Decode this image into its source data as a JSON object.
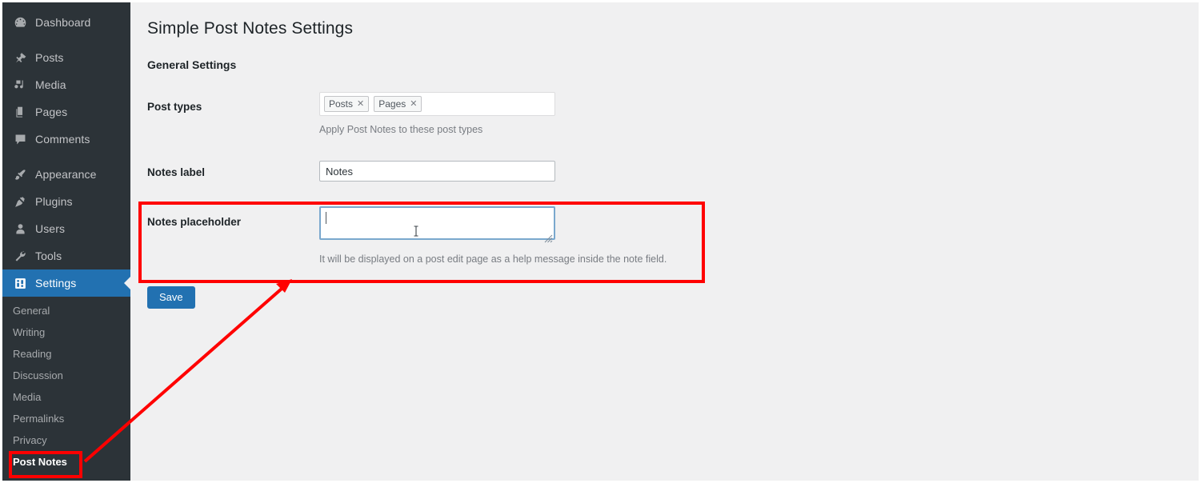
{
  "sidebar": {
    "items": [
      {
        "label": "Dashboard",
        "icon": "dashboard-icon",
        "name": "sidebar-item-dashboard"
      },
      {
        "label": "Posts",
        "icon": "pin-icon",
        "name": "sidebar-item-posts"
      },
      {
        "label": "Media",
        "icon": "media-icon",
        "name": "sidebar-item-media"
      },
      {
        "label": "Pages",
        "icon": "pages-icon",
        "name": "sidebar-item-pages"
      },
      {
        "label": "Comments",
        "icon": "comment-icon",
        "name": "sidebar-item-comments"
      },
      {
        "label": "Appearance",
        "icon": "paintbrush-icon",
        "name": "sidebar-item-appearance"
      },
      {
        "label": "Plugins",
        "icon": "plug-icon",
        "name": "sidebar-item-plugins"
      },
      {
        "label": "Users",
        "icon": "user-icon",
        "name": "sidebar-item-users"
      },
      {
        "label": "Tools",
        "icon": "wrench-icon",
        "name": "sidebar-item-tools"
      },
      {
        "label": "Settings",
        "icon": "sliders-icon",
        "name": "sidebar-item-settings"
      }
    ],
    "submenu": [
      {
        "label": "General"
      },
      {
        "label": "Writing"
      },
      {
        "label": "Reading"
      },
      {
        "label": "Discussion"
      },
      {
        "label": "Media"
      },
      {
        "label": "Permalinks"
      },
      {
        "label": "Privacy"
      },
      {
        "label": "Post Notes"
      }
    ],
    "active_item": "Settings",
    "current_submenu": "Post Notes",
    "colors": {
      "background": "#2c3338",
      "active": "#2271b1",
      "text": "#c3c4c7",
      "submenu_text": "#a7aaad"
    }
  },
  "header": {
    "page_title": "Simple Post Notes Settings",
    "section_title": "General Settings"
  },
  "form": {
    "post_types": {
      "label": "Post types",
      "tags": [
        {
          "label": "Posts",
          "remove": "✕"
        },
        {
          "label": "Pages",
          "remove": "✕"
        }
      ],
      "help": "Apply Post Notes to these post types"
    },
    "notes_label": {
      "label": "Notes label",
      "value": "Notes",
      "placeholder": ""
    },
    "notes_placeholder": {
      "label": "Notes placeholder",
      "value": "",
      "placeholder": "",
      "help": "It will be displayed on a post edit page as a help message inside the note field.",
      "focused": true
    },
    "save_label": "Save"
  },
  "annotations": {
    "color": "#ff0000",
    "highlight_row": "notes-placeholder-row",
    "highlight_menu": "Post Notes",
    "arrow": "points from Post Notes menu item to Notes placeholder row"
  }
}
